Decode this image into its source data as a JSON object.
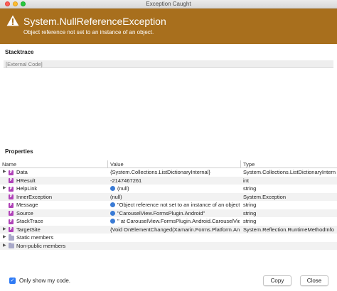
{
  "window": {
    "title": "Exception Caught"
  },
  "exception": {
    "type": "System.NullReferenceException",
    "message": "Object reference not set to an instance of an object."
  },
  "stacktrace": {
    "label": "Stacktrace",
    "frames": [
      "[External Code]"
    ]
  },
  "properties": {
    "label": "Properties",
    "columns": {
      "name": "Name",
      "value": "Value",
      "type": "Type"
    },
    "rows": [
      {
        "name": "Data",
        "value": "{System.Collections.ListDictionaryInternal}",
        "type": "System.Collections.ListDictionaryInterna"
      },
      {
        "name": "HResult",
        "value": "-2147467261",
        "type": "int"
      },
      {
        "name": "HelpLink",
        "value": "(null)",
        "type": "string"
      },
      {
        "name": "InnerException",
        "value": "(null)",
        "type": "System.Exception"
      },
      {
        "name": "Message",
        "value": "\"Object reference not set to an instance of an object.\"",
        "type": "string"
      },
      {
        "name": "Source",
        "value": "\"CarouselView.FormsPlugin.Android\"",
        "type": "string"
      },
      {
        "name": "StackTrace",
        "value": "\"  at CarouselView.FormsPlugin.Android.CarouselViewR",
        "type": "string"
      },
      {
        "name": "TargetSite",
        "value": "{Void OnElementChanged(Xamarin.Forms.Platform.Androi",
        "type": "System.Reflection.RuntimeMethodInfo"
      },
      {
        "name": "Static members",
        "value": "",
        "type": ""
      },
      {
        "name": "Non-public members",
        "value": "",
        "type": ""
      }
    ]
  },
  "footer": {
    "only_my_code_label": "Only show my code.",
    "only_my_code_checked": true,
    "copy_label": "Copy",
    "close_label": "Close"
  },
  "colors": {
    "banner": "#a86f1d",
    "property_icon": "#b043b8",
    "checkbox": "#2f7bf5"
  }
}
